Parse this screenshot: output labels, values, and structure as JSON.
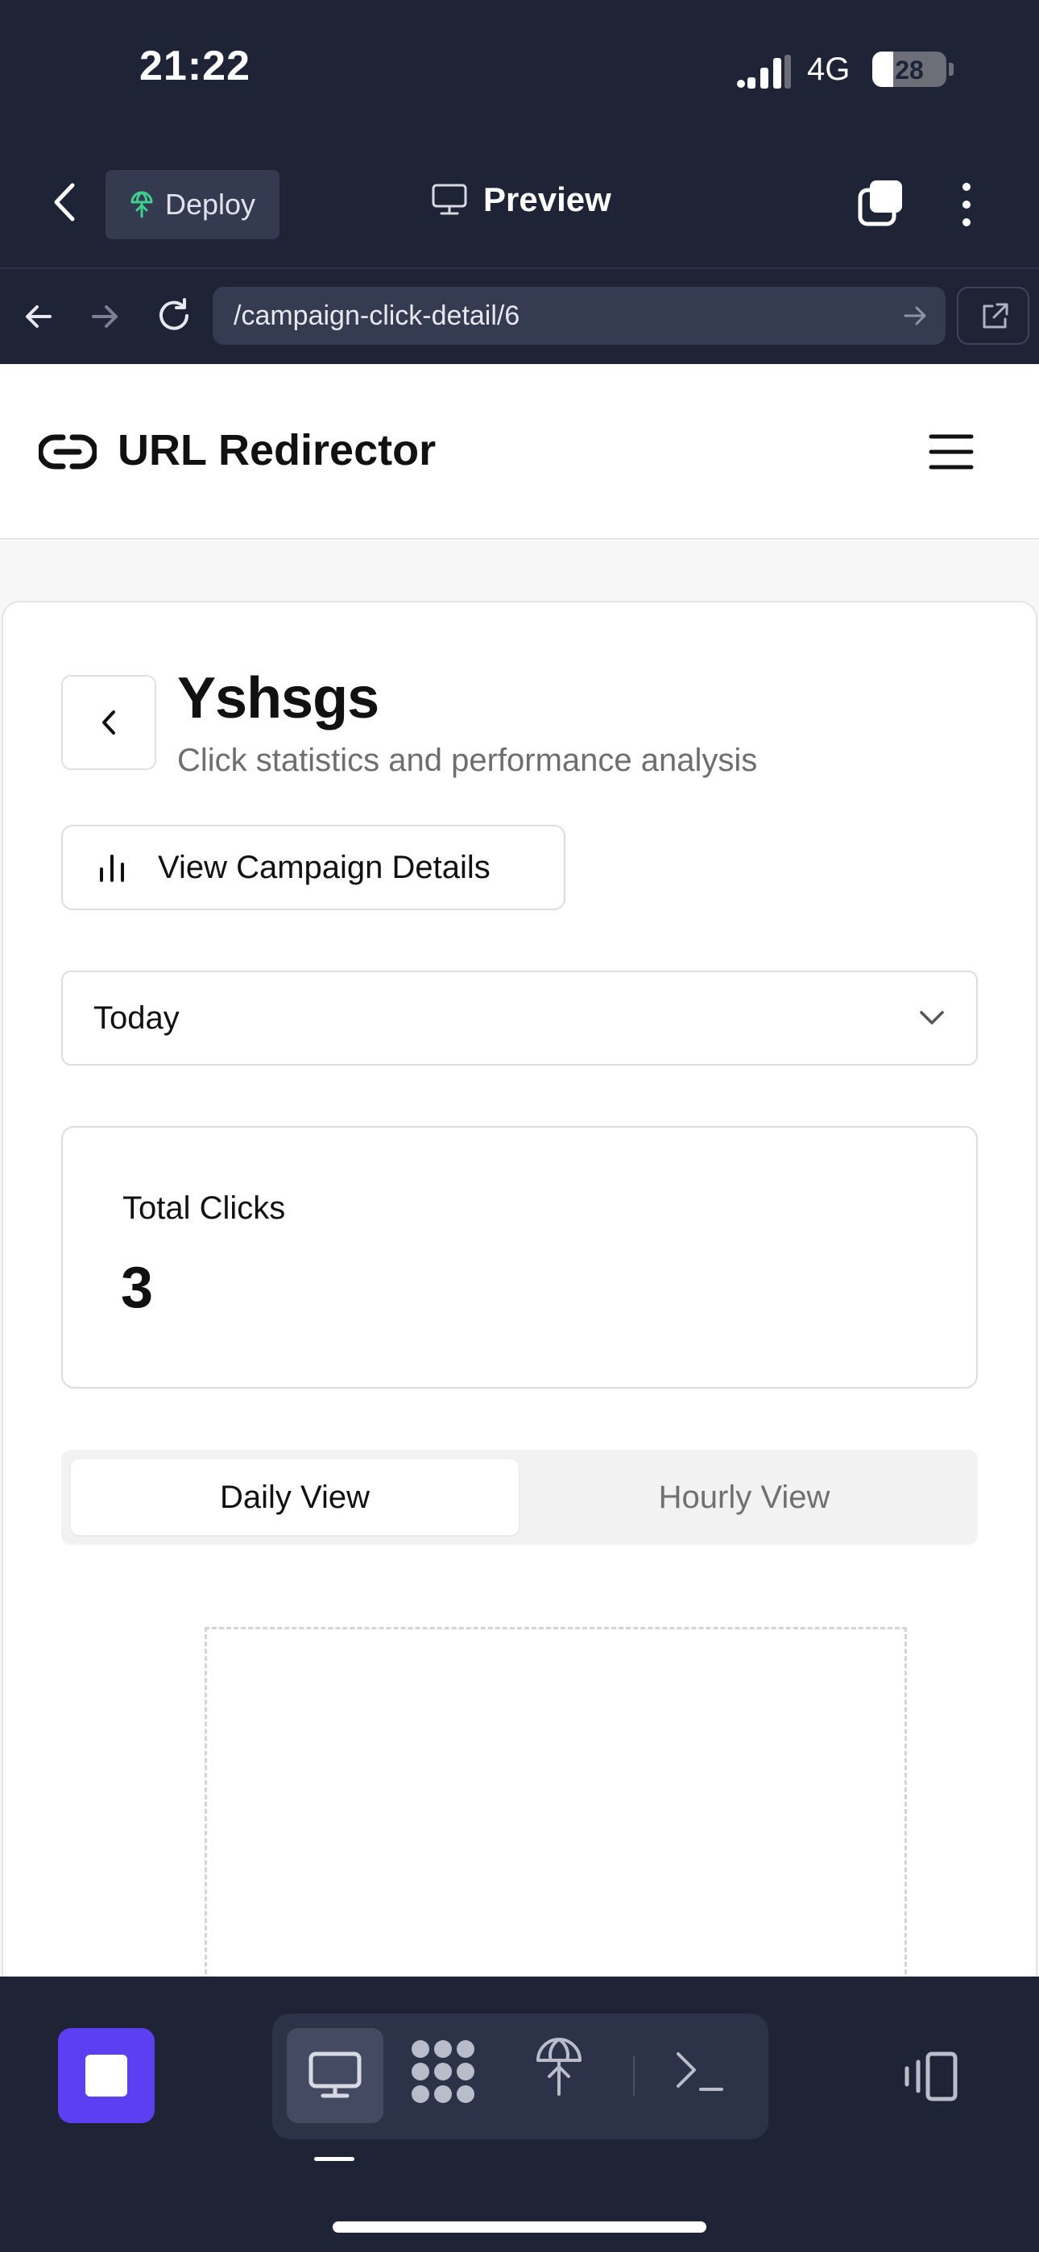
{
  "status_bar": {
    "time": "21:22",
    "network": "4G",
    "battery": "28",
    "battery_level": 0.28
  },
  "ide_toolbar": {
    "deploy_label": "Deploy",
    "preview_label": "Preview",
    "icons": [
      "back-chevron-icon",
      "deploy-globe-icon",
      "monitor-icon",
      "tabs-icon",
      "more-vertical-icon"
    ]
  },
  "browser": {
    "url": "/campaign-click-detail/6",
    "icons": [
      "arrow-left-icon",
      "arrow-right-icon",
      "reload-icon",
      "url-go-arrow-icon",
      "external-link-icon"
    ]
  },
  "site": {
    "brand": "URL Redirector",
    "brand_icon": "link-icon",
    "menu_icon": "hamburger-icon"
  },
  "campaign": {
    "title": "Yshsgs",
    "subtitle": "Click statistics and performance analysis",
    "details_button": "View Campaign Details",
    "date_range": {
      "selected": "Today"
    },
    "stats": {
      "total_clicks_label": "Total Clicks",
      "total_clicks_value": "3"
    },
    "view_tabs": [
      {
        "label": "Daily View",
        "active": true
      },
      {
        "label": "Hourly View",
        "active": false
      }
    ]
  },
  "dock": {
    "icons": [
      "stop-icon",
      "preview-monitor-icon",
      "apps-grid-icon",
      "deploy-icon",
      "shell-icon",
      "layout-toggle-icon"
    ]
  },
  "colors": {
    "chrome_bg": "#1e2335",
    "accent_purple": "#5b3ff0",
    "deploy_green": "#3ecf8e"
  }
}
